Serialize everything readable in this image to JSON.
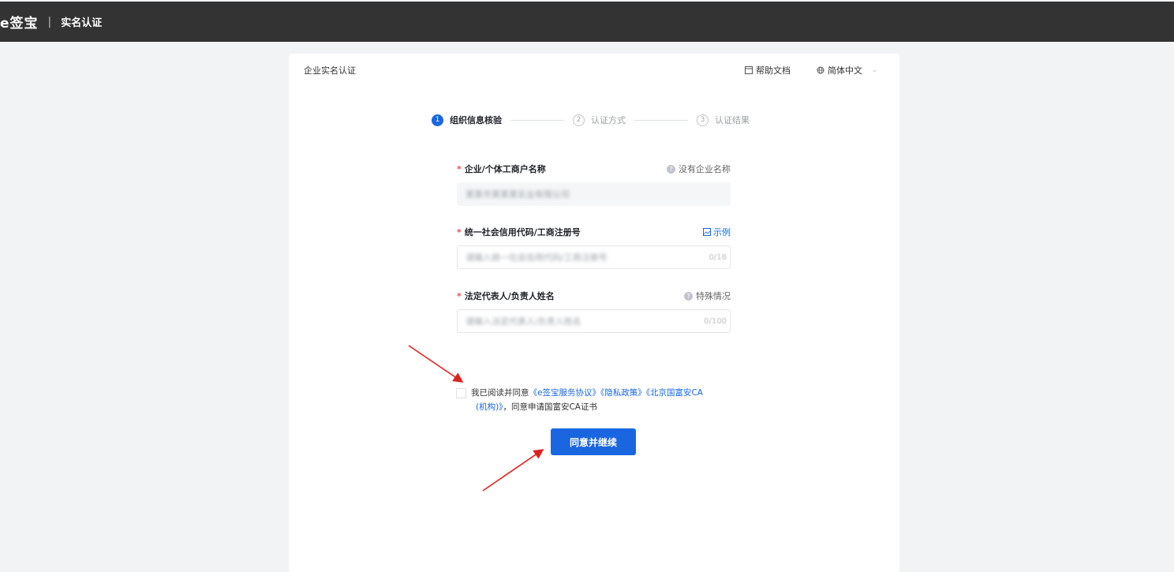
{
  "app": {
    "brand": "e签宝",
    "separator": "|",
    "page_name": "实名认证"
  },
  "card": {
    "title": "企业实名认证",
    "help_label": "帮助文档",
    "language": "简体中文"
  },
  "steps": [
    {
      "num": "1",
      "label": "组织信息核验",
      "state": "active"
    },
    {
      "num": "2",
      "label": "认证方式",
      "state": "inactive"
    },
    {
      "num": "3",
      "label": "认证结果",
      "state": "inactive"
    }
  ],
  "form": {
    "company": {
      "required": "*",
      "label": "企业/个体工商户名称",
      "aux": "没有企业名称",
      "value": "某某市某某某实业有限公司"
    },
    "credit_code": {
      "required": "*",
      "label": "统一社会信用代码/工商注册号",
      "aux": "示例",
      "placeholder": "请输入统一社会信用代码/工商注册号",
      "counter": "0/18"
    },
    "legal_rep": {
      "required": "*",
      "label": "法定代表人/负责人姓名",
      "aux": "特殊情况",
      "placeholder": "请输入法定代表人/负责人姓名",
      "counter": "0/100"
    }
  },
  "agreement": {
    "prefix": "我已阅读并同意",
    "link1": "《e签宝服务协议》",
    "link2": "《隐私政策》",
    "link3_line1": "《北京国富安CA",
    "link3_line2": "(机构)》",
    "suffix": "，同意申请国富安CA证书"
  },
  "submit_label": "同意并继续",
  "colors": {
    "topbar": "#333333",
    "primary": "#1a66e0",
    "annotation_arrow": "#e02020"
  }
}
